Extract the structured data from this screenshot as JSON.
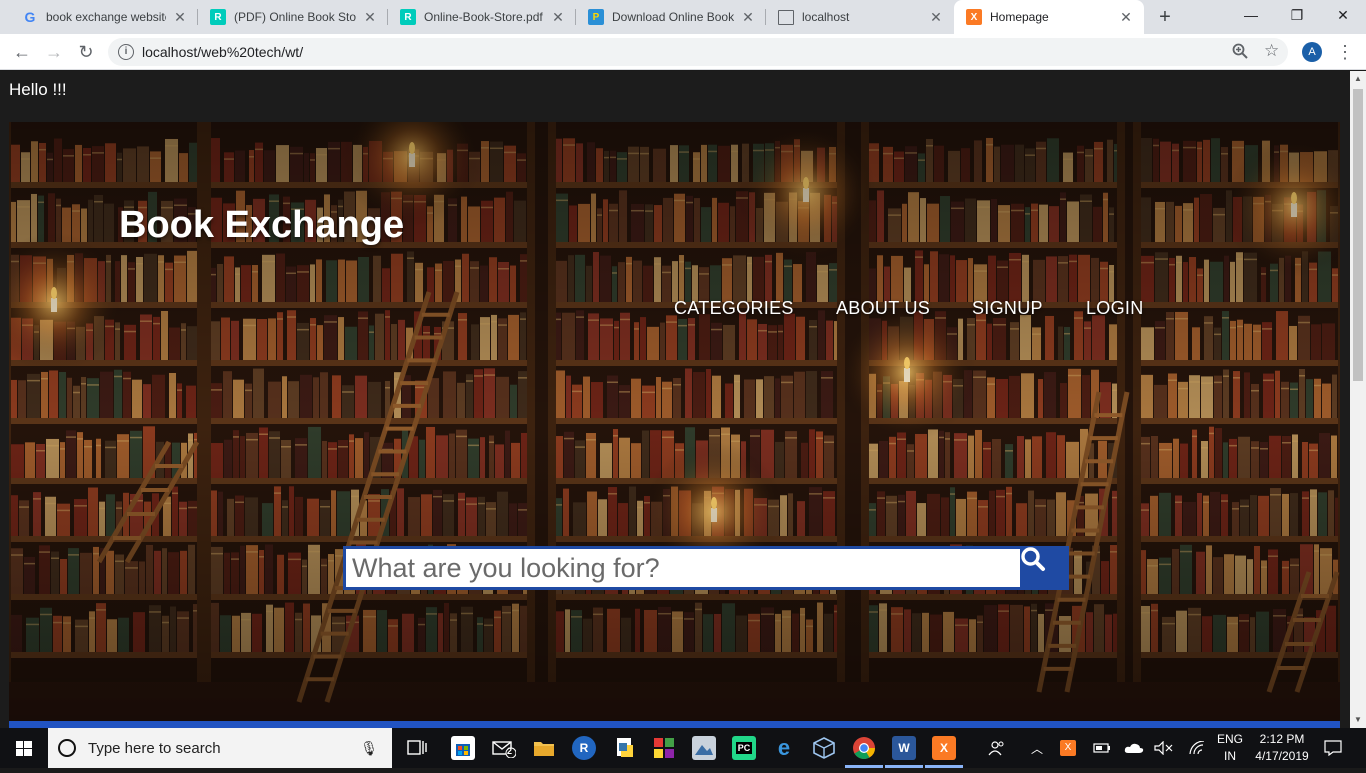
{
  "browser": {
    "tabs": [
      {
        "title": "book exchange website",
        "favicon": "google-icon",
        "active": false
      },
      {
        "title": "(PDF) Online Book Store",
        "favicon": "researchgate-icon",
        "active": false
      },
      {
        "title": "Online-Book-Store.pdf",
        "favicon": "researchgate-icon",
        "active": false
      },
      {
        "title": "Download Online Book",
        "favicon": "projects-icon",
        "active": false
      },
      {
        "title": "localhost",
        "favicon": "document-icon",
        "active": false
      },
      {
        "title": "Homepage",
        "favicon": "xampp-icon",
        "active": true
      }
    ],
    "url": "localhost/web%20tech/wt/",
    "profile_initial": "A"
  },
  "page": {
    "greeting": "Hello !!!",
    "brand": "Book Exchange",
    "nav": {
      "categories": "CATEGORIES",
      "about": "ABOUT US",
      "signup": "SIGNUP",
      "login": "LOGIN"
    },
    "search": {
      "placeholder": "What are you looking for?"
    },
    "colors": {
      "accent": "#1f4aa3",
      "bar": "#2153c2",
      "header_bg": "#1c1c1c"
    }
  },
  "taskbar": {
    "search_placeholder": "Type here to search",
    "language_top": "ENG",
    "language_bottom": "IN",
    "time": "2:12 PM",
    "date": "4/17/2019",
    "mail_badge": "2"
  }
}
